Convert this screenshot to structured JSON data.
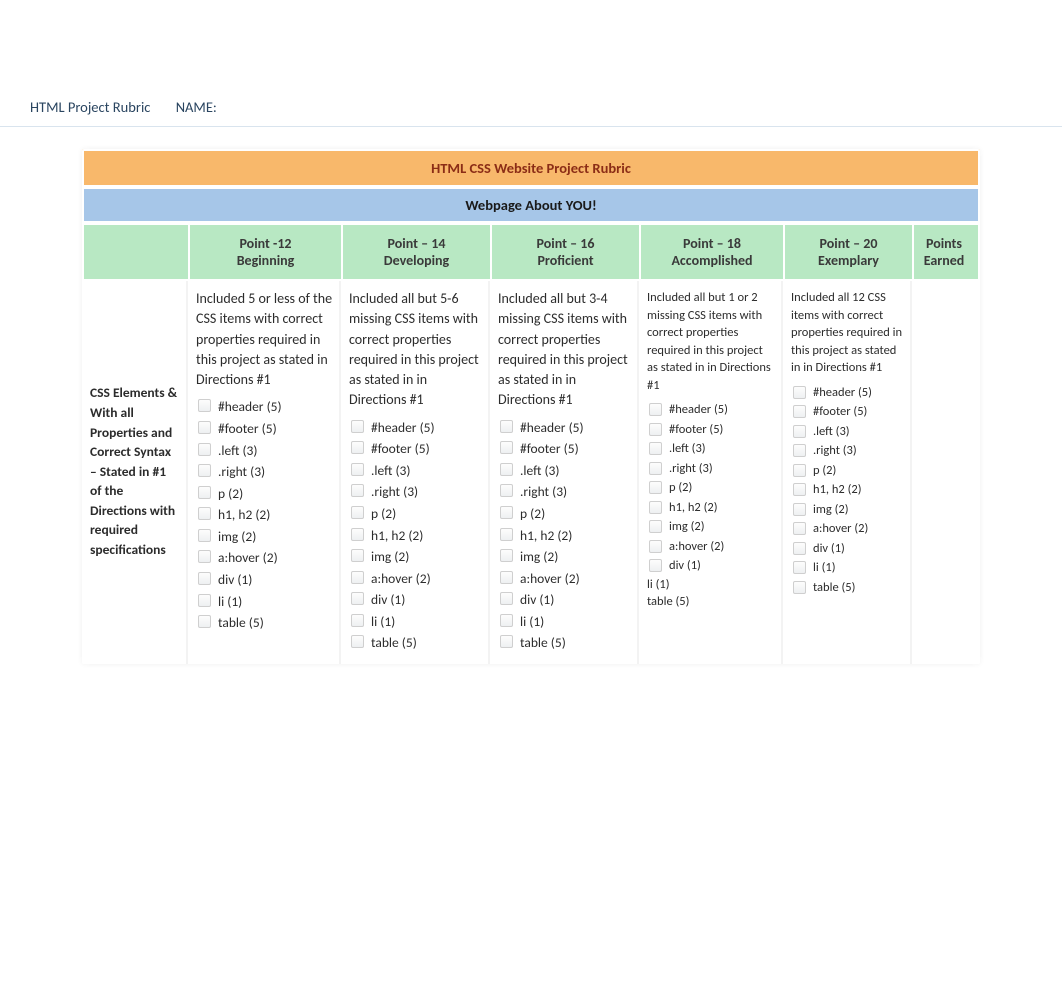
{
  "page": {
    "title": "HTML Project Rubric",
    "name_label": "NAME:"
  },
  "rubric": {
    "title": "HTML CSS Website Project Rubric",
    "subtitle": "Webpage About YOU!",
    "columns": {
      "criterion_header": "",
      "c1": {
        "points": "Point -12",
        "label": "Beginning"
      },
      "c2": {
        "points": "Point – 14",
        "label": "Developing"
      },
      "c3": {
        "points": "Point – 16",
        "label": "Proficient"
      },
      "c4": {
        "points": "Point – 18",
        "label": "Accomplished"
      },
      "c5": {
        "points": "Point – 20",
        "label": "Exemplary"
      },
      "c6": "Points Earned"
    },
    "row1": {
      "criterion": "CSS Elements & With all Properties and Correct Syntax – Stated in #1 of the Directions with required specifications",
      "c1": {
        "desc": "Included 5 or less of the CSS items with correct properties required in this project as stated in Directions #1",
        "items": [
          "#header (5)",
          "#footer (5)",
          ".left (3)",
          ".right (3)",
          "p (2)",
          "h1, h2 (2)",
          "img (2)",
          "a:hover (2)",
          "div (1)",
          "li (1)",
          "table (5)"
        ]
      },
      "c2": {
        "desc": "Included all but 5-6 missing CSS items with correct properties required in this project as stated in in Directions #1",
        "items": [
          "#header (5)",
          "#footer (5)",
          ".left (3)",
          ".right (3)",
          "p (2)",
          "h1, h2 (2)",
          "img (2)",
          "a:hover (2)",
          "div (1)",
          "li (1)",
          "table (5)"
        ]
      },
      "c3": {
        "desc": "Included all but 3-4 missing CSS items with correct properties required in this project as stated in in Directions #1",
        "items": [
          "#header (5)",
          "#footer (5)",
          ".left (3)",
          ".right (3)",
          "p (2)",
          "h1, h2 (2)",
          "img (2)",
          "a:hover (2)",
          "div (1)",
          "li (1)",
          "table (5)"
        ]
      },
      "c4": {
        "desc": "Included all but 1 or 2 missing CSS items with correct properties required in this project as stated in in Directions #1",
        "items": [
          "#header (5)",
          "#footer (5)",
          ".left (3)",
          ".right (3)",
          "p (2)",
          "h1, h2 (2)",
          "img (2)",
          "a:hover (2)",
          "div (1)"
        ],
        "extra": [
          "li (1)",
          "table (5)"
        ]
      },
      "c5": {
        "desc": "Included all 12 CSS items with correct properties required in this project as stated in in Directions #1",
        "items": [
          "#header (5)",
          "#footer (5)",
          ".left (3)",
          ".right (3)",
          "p (2)",
          "h1, h2 (2)",
          "img (2)",
          "a:hover (2)",
          "div (1)",
          "li (1)",
          "table (5)"
        ]
      }
    }
  }
}
